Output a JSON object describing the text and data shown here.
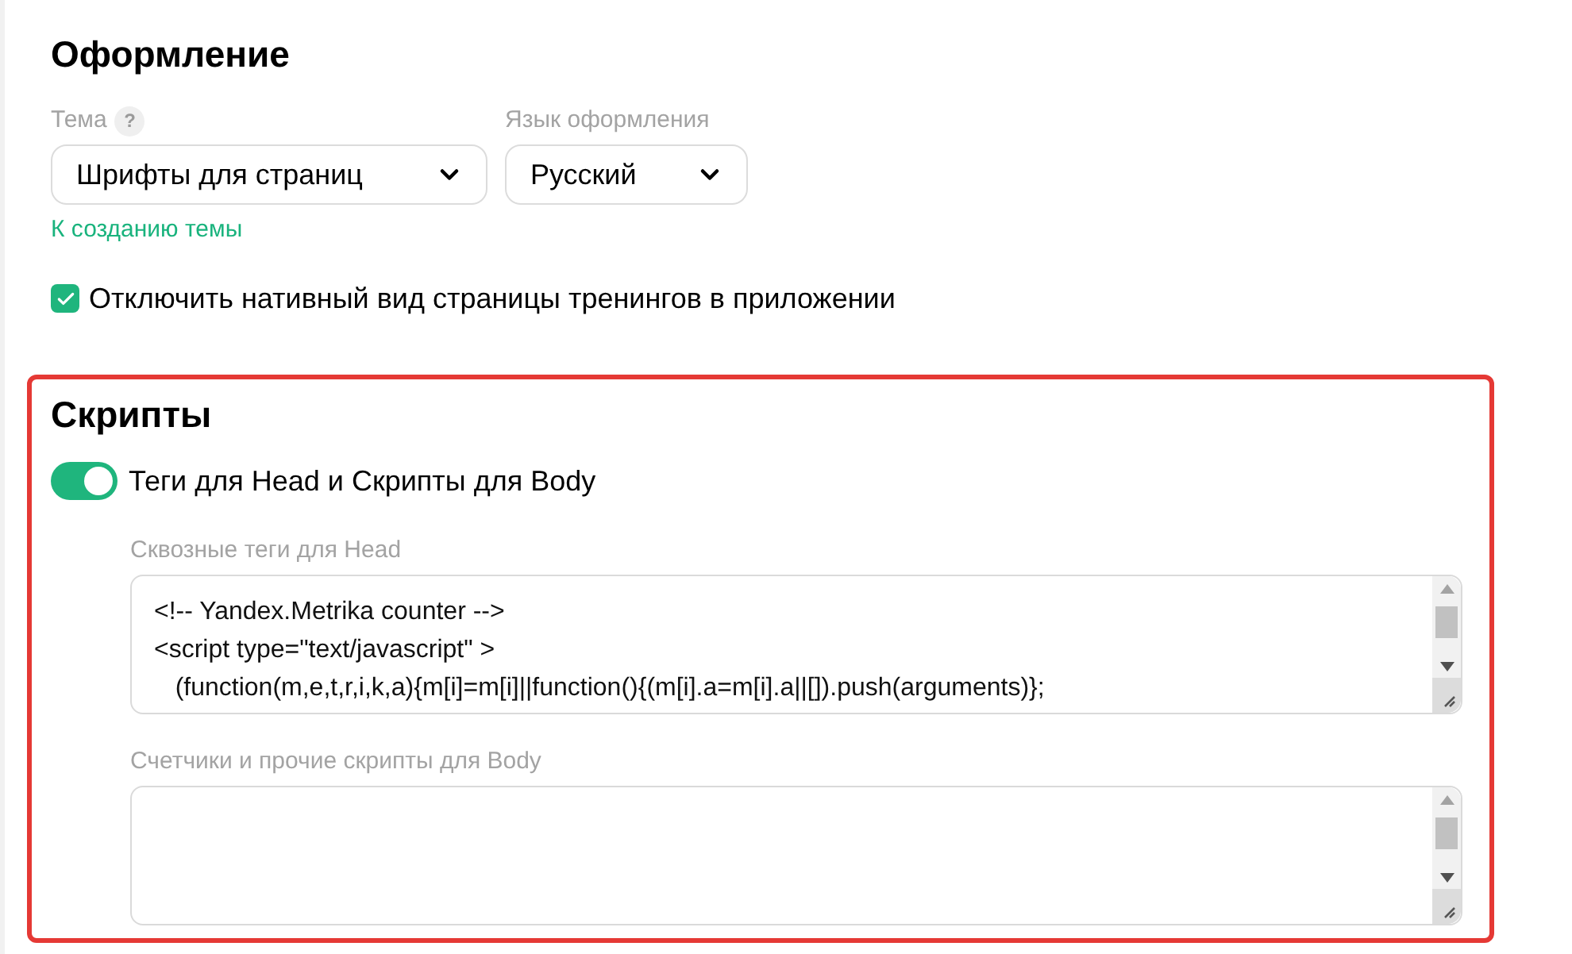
{
  "appearance": {
    "title": "Оформление",
    "theme": {
      "label": "Тема",
      "help": "?",
      "value": "Шрифты для страниц"
    },
    "language": {
      "label": "Язык оформления",
      "value": "Русский"
    },
    "create_theme_link": "К созданию темы",
    "native_view_checkbox": {
      "label": "Отключить нативный вид страницы тренингов в приложении",
      "checked": true
    }
  },
  "scripts": {
    "title": "Скрипты",
    "highlighted": true,
    "toggle": {
      "label": "Теги для Head и Скрипты для Body",
      "on": true
    },
    "fields": [
      {
        "label": "Сквозные теги для Head",
        "value": "<!-- Yandex.Metrika counter -->\n<script type=\"text/javascript\" >\n   (function(m,e,t,r,i,k,a){m[i]=m[i]||function(){(m[i].a=m[i].a||[]).push(arguments)};"
      },
      {
        "label": "Счетчики и прочие скрипты для Body"
      }
    ]
  }
}
